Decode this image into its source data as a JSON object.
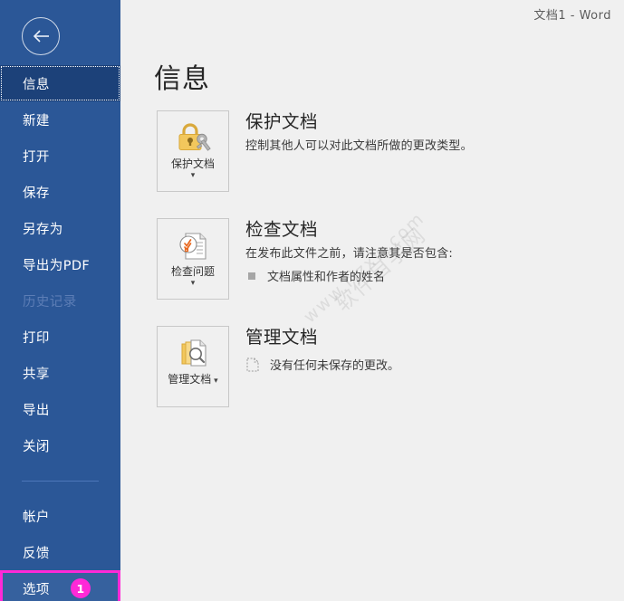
{
  "window": {
    "title": "文档1  -  Word"
  },
  "sidebar": {
    "back_icon": "back-arrow-icon",
    "items": [
      {
        "label": "信息",
        "state": "selected",
        "name": "info"
      },
      {
        "label": "新建",
        "state": "normal",
        "name": "new"
      },
      {
        "label": "打开",
        "state": "normal",
        "name": "open"
      },
      {
        "label": "保存",
        "state": "normal",
        "name": "save"
      },
      {
        "label": "另存为",
        "state": "normal",
        "name": "save-as"
      },
      {
        "label": "导出为PDF",
        "state": "normal",
        "name": "export-pdf"
      },
      {
        "label": "历史记录",
        "state": "disabled",
        "name": "history"
      },
      {
        "label": "打印",
        "state": "normal",
        "name": "print"
      },
      {
        "label": "共享",
        "state": "normal",
        "name": "share"
      },
      {
        "label": "导出",
        "state": "normal",
        "name": "export"
      },
      {
        "label": "关闭",
        "state": "normal",
        "name": "close"
      },
      {
        "label": "",
        "state": "separator",
        "name": "separator"
      },
      {
        "label": "帐户",
        "state": "normal",
        "name": "account"
      },
      {
        "label": "反馈",
        "state": "normal",
        "name": "feedback"
      },
      {
        "label": "选项",
        "state": "highlighted",
        "name": "options",
        "badge": "1"
      }
    ]
  },
  "main": {
    "page_title": "信息",
    "watermark_line1": "软件自学网",
    "watermark_line2": "www.rjzxw.com",
    "sections": [
      {
        "button_label": "保护文档",
        "button_icon": "lock-key-icon",
        "heading": "保护文档",
        "desc": "控制其他人可以对此文档所做的更改类型。",
        "bullets": [],
        "note": null,
        "caret_inline": false
      },
      {
        "button_label": "检查问题",
        "button_icon": "document-check-icon",
        "heading": "检查文档",
        "desc": "在发布此文件之前，请注意其是否包含:",
        "bullets": [
          "文档属性和作者的姓名"
        ],
        "note": null,
        "caret_inline": false
      },
      {
        "button_label": "管理文档",
        "button_icon": "document-search-icon",
        "heading": "管理文档",
        "desc": null,
        "bullets": [],
        "note": "没有任何未保存的更改。",
        "note_icon": "dashed-document-icon",
        "caret_inline": true
      }
    ]
  },
  "colors": {
    "sidebar_bg": "#2b5797",
    "sidebar_selected": "#1c4179",
    "accent_highlight": "#ff29d7",
    "main_bg": "#f0f0f0"
  }
}
